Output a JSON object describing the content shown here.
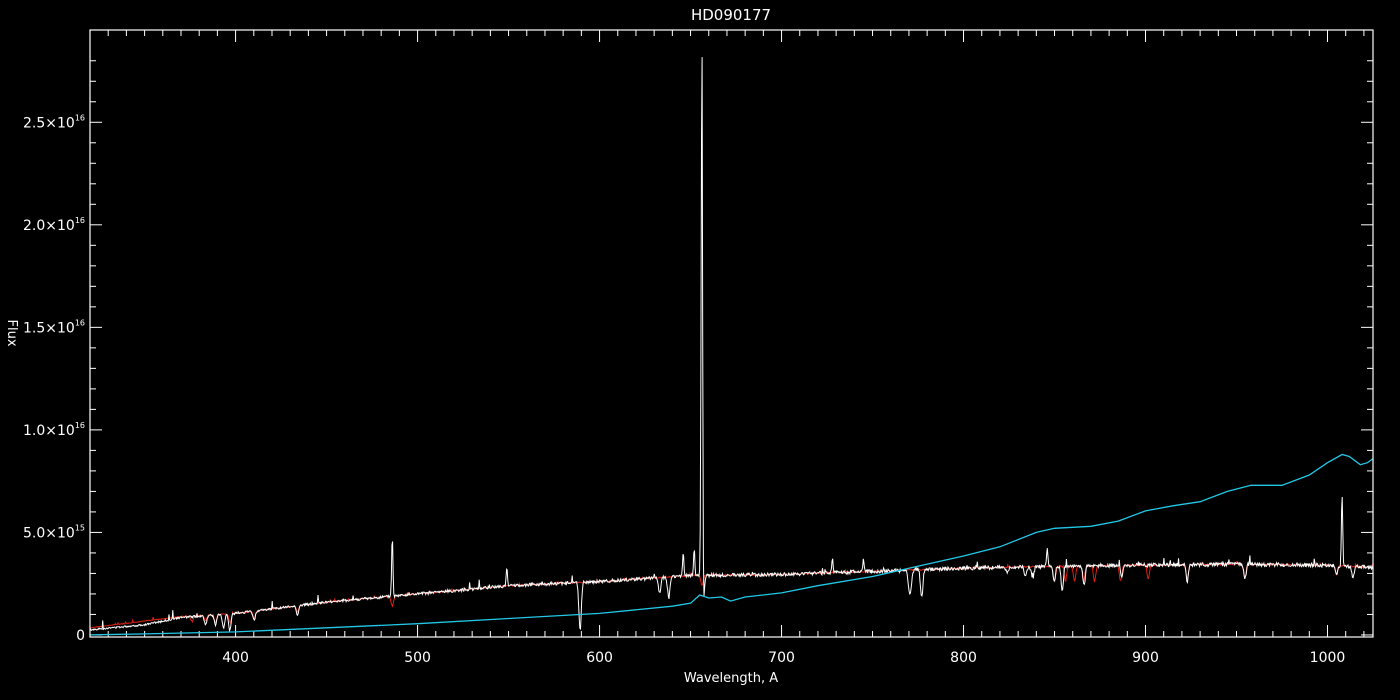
{
  "chart_data": {
    "type": "line",
    "title": "HD090177",
    "xlabel": "Wavelength, A",
    "ylabel": "Flux",
    "xlim": [
      320,
      1025
    ],
    "ylim": [
      -100000000000000.0,
      2.95e+16
    ],
    "x_ticks": [
      400,
      500,
      600,
      700,
      800,
      900,
      1000
    ],
    "x_tick_labels": [
      "400",
      "500",
      "600",
      "700",
      "800",
      "900",
      "1000"
    ],
    "y_ticks": [
      {
        "value": 0,
        "mantissa": "0",
        "exp": ""
      },
      {
        "value": 5000000000000000.0,
        "mantissa": "5.0×10",
        "exp": "15"
      },
      {
        "value": 1e+16,
        "mantissa": "1.0×10",
        "exp": "16"
      },
      {
        "value": 1.5e+16,
        "mantissa": "1.5×10",
        "exp": "16"
      },
      {
        "value": 2e+16,
        "mantissa": "2.0×10",
        "exp": "16"
      },
      {
        "value": 2.5e+16,
        "mantissa": "2.5×10",
        "exp": "16"
      }
    ],
    "grid": false,
    "series": [
      {
        "color": "#ffffff",
        "continuum": [
          [
            320,
            250000000000000.0
          ],
          [
            350,
            500000000000000.0
          ],
          [
            370,
            850000000000000.0
          ],
          [
            400,
            1050000000000000.0
          ],
          [
            450,
            1600000000000000.0
          ],
          [
            500,
            2000000000000000.0
          ],
          [
            550,
            2400000000000000.0
          ],
          [
            600,
            2600000000000000.0
          ],
          [
            650,
            2900000000000000.0
          ],
          [
            700,
            2950000000000000.0
          ],
          [
            750,
            3100000000000000.0
          ],
          [
            800,
            3250000000000000.0
          ],
          [
            850,
            3350000000000000.0
          ],
          [
            900,
            3400000000000000.0
          ],
          [
            950,
            3450000000000000.0
          ],
          [
            1000,
            3400000000000000.0
          ],
          [
            1025,
            3300000000000000.0
          ]
        ],
        "emission_peaks": [
          [
            486.1,
            4800000000000000.0
          ],
          [
            656.3,
            2.85e+16
          ],
          [
            655.8,
            8000000000000000.0
          ],
          [
            1008,
            6800000000000000.0
          ],
          [
            549,
            3300000000000000.0
          ],
          [
            646,
            4000000000000000.0
          ],
          [
            652,
            4200000000000000.0
          ],
          [
            728,
            3800000000000000.0
          ],
          [
            745,
            3700000000000000.0
          ],
          [
            846,
            4200000000000000.0
          ]
        ],
        "absorption_lines": [
          [
            589.3,
            200000000000000.0
          ],
          [
            396.8,
            200000000000000.0
          ],
          [
            393.4,
            300000000000000.0
          ],
          [
            383.5,
            500000000000000.0
          ],
          [
            388.9,
            500000000000000.0
          ],
          [
            410.2,
            700000000000000.0
          ],
          [
            434.0,
            1000000000000000.0
          ],
          [
            656.8,
            1000000000000000.0
          ],
          [
            777.0,
            1800000000000000.0
          ],
          [
            771,
            2300000000000000.0
          ],
          [
            849.8,
            2600000000000000.0
          ],
          [
            854.2,
            2200000000000000.0
          ],
          [
            866.2,
            2400000000000000.0
          ],
          [
            887,
            2800000000000000.0
          ],
          [
            922.9,
            2600000000000000.0
          ],
          [
            954.6,
            2700000000000000.0
          ],
          [
            1005,
            2900000000000000.0
          ],
          [
            1014,
            2800000000000000.0
          ],
          [
            633,
            2000000000000000.0
          ],
          [
            638,
            1800000000000000.0
          ],
          [
            770,
            2500000000000000.0
          ],
          [
            838,
            2700000000000000.0
          ],
          [
            834,
            2800000000000000.0
          ],
          [
            824,
            3000000000000000.0
          ]
        ]
      },
      {
        "color": "#e02010",
        "continuum": [
          [
            320,
            350000000000000.0
          ],
          [
            370,
            900000000000000.0
          ],
          [
            400,
            1050000000000000.0
          ],
          [
            450,
            1600000000000000.0
          ],
          [
            500,
            2000000000000000.0
          ],
          [
            550,
            2400000000000000.0
          ],
          [
            600,
            2600000000000000.0
          ],
          [
            650,
            2900000000000000.0
          ],
          [
            700,
            2950000000000000.0
          ],
          [
            750,
            3100000000000000.0
          ],
          [
            800,
            3250000000000000.0
          ],
          [
            850,
            3350000000000000.0
          ],
          [
            900,
            3400000000000000.0
          ],
          [
            950,
            3450000000000000.0
          ],
          [
            1000,
            3400000000000000.0
          ],
          [
            1025,
            3300000000000000.0
          ]
        ],
        "absorption_lines": [
          [
            376,
            600000000000000.0
          ],
          [
            383.5,
            700000000000000.0
          ],
          [
            388.9,
            600000000000000.0
          ],
          [
            397,
            600000000000000.0
          ],
          [
            410.2,
            800000000000000.0
          ],
          [
            434.0,
            1100000000000000.0
          ],
          [
            486.1,
            1400000000000000.0
          ],
          [
            656.3,
            2400000000000000.0
          ],
          [
            850,
            2600000000000000.0
          ],
          [
            856,
            2600000000000000.0
          ],
          [
            861,
            2600000000000000.0
          ],
          [
            866,
            2600000000000000.0
          ],
          [
            872,
            2600000000000000.0
          ],
          [
            886.3,
            2600000000000000.0
          ],
          [
            901.5,
            2700000000000000.0
          ],
          [
            922.9,
            2700000000000000.0
          ],
          [
            954.6,
            2800000000000000.0
          ],
          [
            1005,
            2900000000000000.0
          ]
        ]
      },
      {
        "color": "#22c8e6",
        "points": [
          [
            320,
            0.0
          ],
          [
            350,
            50000000000000.0
          ],
          [
            400,
            150000000000000.0
          ],
          [
            450,
            350000000000000.0
          ],
          [
            500,
            550000000000000.0
          ],
          [
            550,
            800000000000000.0
          ],
          [
            600,
            1050000000000000.0
          ],
          [
            640,
            1400000000000000.0
          ],
          [
            650,
            1550000000000000.0
          ],
          [
            655,
            1950000000000000.0
          ],
          [
            660,
            1800000000000000.0
          ],
          [
            667,
            1850000000000000.0
          ],
          [
            672,
            1650000000000000.0
          ],
          [
            680,
            1850000000000000.0
          ],
          [
            700,
            2050000000000000.0
          ],
          [
            720,
            2400000000000000.0
          ],
          [
            750,
            2850000000000000.0
          ],
          [
            770,
            3250000000000000.0
          ],
          [
            800,
            3850000000000000.0
          ],
          [
            820,
            4300000000000000.0
          ],
          [
            840,
            5000000000000000.0
          ],
          [
            850,
            5200000000000000.0
          ],
          [
            870,
            5300000000000000.0
          ],
          [
            885,
            5550000000000000.0
          ],
          [
            900,
            6050000000000000.0
          ],
          [
            915,
            6300000000000000.0
          ],
          [
            930,
            6500000000000000.0
          ],
          [
            945,
            7000000000000000.0
          ],
          [
            958,
            7300000000000000.0
          ],
          [
            975,
            7300000000000000.0
          ],
          [
            990,
            7800000000000000.0
          ],
          [
            1000,
            8400000000000000.0
          ],
          [
            1008,
            8800000000000000.0
          ],
          [
            1012,
            8700000000000000.0
          ],
          [
            1018,
            8300000000000000.0
          ],
          [
            1022,
            8400000000000000.0
          ],
          [
            1025,
            8600000000000000.0
          ]
        ]
      }
    ]
  }
}
